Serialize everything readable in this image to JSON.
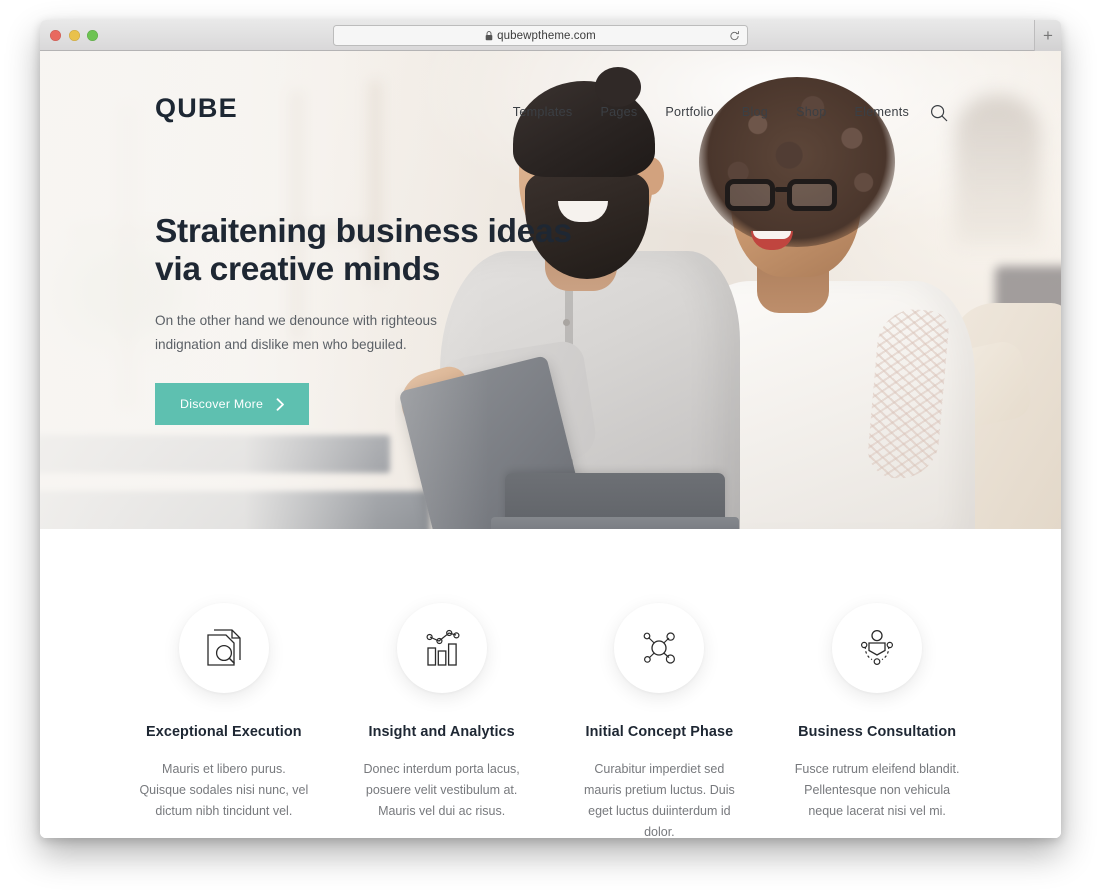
{
  "browser": {
    "url": "qubewptheme.com",
    "lock_icon": "lock-icon",
    "reload_icon": "reload-icon",
    "new_tab_label": "+",
    "traffic_lights": [
      "close",
      "minimize",
      "zoom"
    ]
  },
  "site": {
    "logo": "QUBE",
    "nav": [
      {
        "label": "Templates"
      },
      {
        "label": "Pages"
      },
      {
        "label": "Portfolio"
      },
      {
        "label": "Blog"
      },
      {
        "label": "Shop"
      },
      {
        "label": "Elements"
      }
    ],
    "search_icon": "search-icon"
  },
  "hero": {
    "title_line1": "Straitening business ideas",
    "title_line2": "via creative minds",
    "subtitle": "On the other hand we denounce with righteous indignation and dislike men who beguiled.",
    "cta_label": "Discover More",
    "cta_icon": "chevron-right-icon",
    "cta_color": "#5ec0b0"
  },
  "features": [
    {
      "icon": "document-search-icon",
      "title": "Exceptional Execution",
      "text": "Mauris et libero purus. Quisque sodales nisi nunc, vel dictum nibh tincidunt vel."
    },
    {
      "icon": "bar-chart-analytics-icon",
      "title": "Insight and Analytics",
      "text": "Donec interdum porta lacus, posuere velit vestibulum at. Mauris vel dui ac risus."
    },
    {
      "icon": "molecule-network-icon",
      "title": "Initial Concept Phase",
      "text": "Curabitur imperdiet sed mauris pretium luctus. Duis eget luctus duiinterdum id dolor."
    },
    {
      "icon": "consultation-person-icon",
      "title": "Business Consultation",
      "text": "Fusce rutrum eleifend blandit. Pellentesque non vehicula neque lacerat nisi vel mi."
    }
  ]
}
